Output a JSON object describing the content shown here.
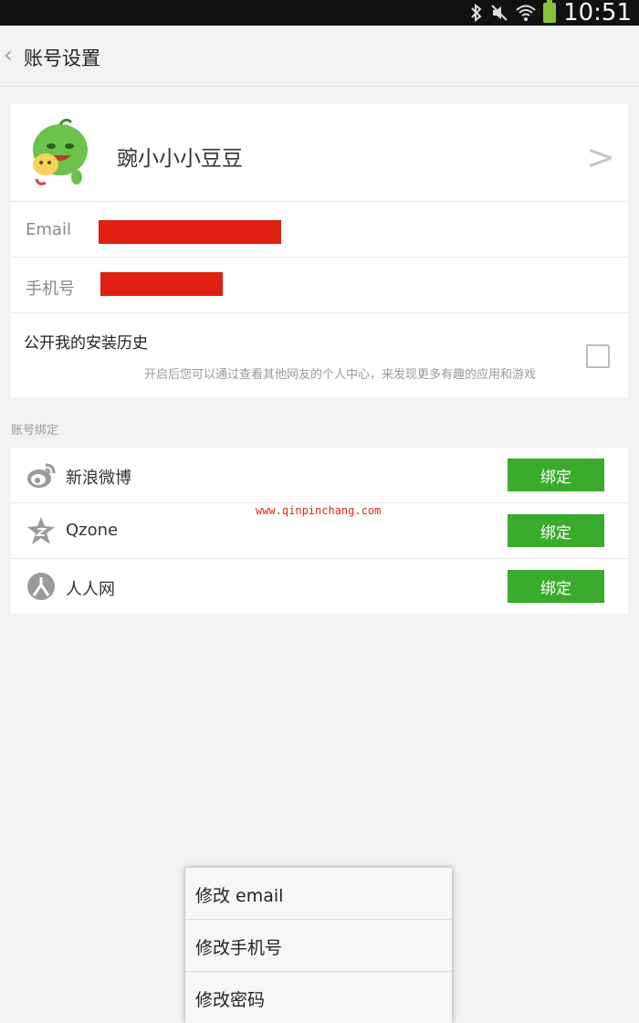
{
  "status_bar": {
    "time": "10:51",
    "icons": [
      "bluetooth-icon",
      "mute-icon",
      "wifi-icon",
      "battery-icon"
    ]
  },
  "header": {
    "back_icon": "back-chevron-icon",
    "title": "账号设置"
  },
  "profile": {
    "username": "豌小小小豆豆",
    "avatar": "green-pea-cartoon-avatar",
    "email_label": "Email",
    "phone_label": "手机号",
    "history_title": "公开我的安装历史",
    "history_desc": "开启后您可以通过查看其他网友的个人中心，来发现更多有趣的应用和游戏",
    "history_checked": false
  },
  "binding": {
    "section_label": "账号绑定",
    "items": [
      {
        "name": "新浪微博",
        "icon": "weibo-icon",
        "button": "绑定"
      },
      {
        "name": "Qzone",
        "icon": "qzone-star-icon",
        "button": "绑定"
      },
      {
        "name": "人人网",
        "icon": "renren-icon",
        "button": "绑定"
      }
    ]
  },
  "watermark": "www.qinpinchang.com",
  "popup_menu": {
    "items": [
      "修改 email",
      "修改手机号",
      "修改密码"
    ]
  },
  "colors": {
    "accent_green": "#3aab2c",
    "redaction": "#e02010",
    "background": "#f2f2f2"
  }
}
